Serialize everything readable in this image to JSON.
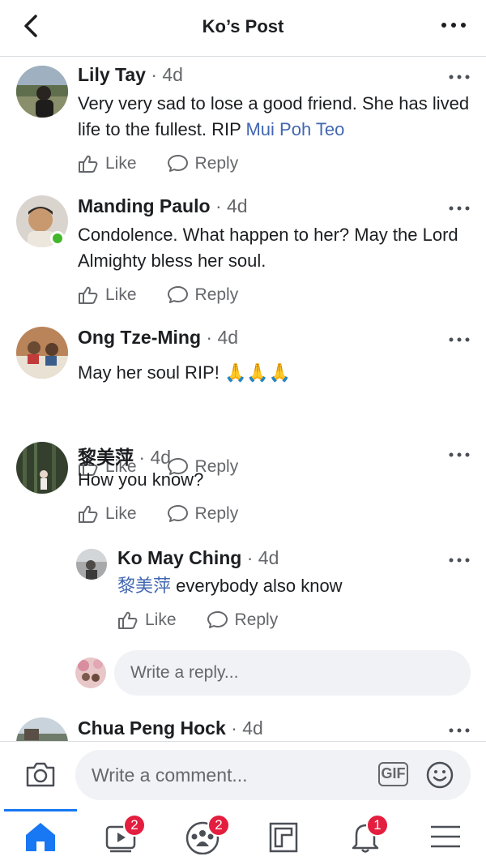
{
  "header": {
    "title": "Ko’s Post"
  },
  "comments": [
    {
      "name": "Lily Tay",
      "time": " · 4d",
      "text": "Very very sad to lose a good friend. She has lived life to the fullest. RIP ",
      "mention": "Mui Poh Teo",
      "like": "Like",
      "reply": "Reply"
    },
    {
      "name": "Manding Paulo",
      "time": " · 4d",
      "text": "Condolence. What happen to her? May the Lord Almighty bless her soul.",
      "like": "Like",
      "reply": "Reply"
    },
    {
      "name": "Ong Tze-Ming",
      "time": " · 4d",
      "text": "May her soul RIP! 🙏🙏🙏",
      "like": "Like",
      "reply": "Reply"
    },
    {
      "name": "黎美萍",
      "time": " · 4d",
      "text": "How you know?",
      "like": "Like",
      "reply": "Reply"
    },
    {
      "name": "Ko May Ching",
      "time": " · 4d",
      "mention": "黎美萍",
      "text": " everybody also know",
      "like": "Like",
      "reply": "Reply"
    },
    {
      "name": "Chua Peng Hock",
      "time": " · 4d"
    }
  ],
  "reply_box": {
    "placeholder": "Write a reply..."
  },
  "composer": {
    "placeholder": "Write a comment...",
    "gif_label": "GIF"
  },
  "tabbar": {
    "items": [
      {
        "icon": "home-icon",
        "badge": ""
      },
      {
        "icon": "video-icon",
        "badge": "2"
      },
      {
        "icon": "groups-icon",
        "badge": "2"
      },
      {
        "icon": "pages-icon",
        "badge": ""
      },
      {
        "icon": "bell-icon",
        "badge": "1"
      },
      {
        "icon": "menu-icon",
        "badge": ""
      }
    ]
  },
  "colors": {
    "accent": "#1877f2",
    "mention": "#4267b2",
    "badge": "#e41e3f",
    "online": "#42b72a"
  }
}
